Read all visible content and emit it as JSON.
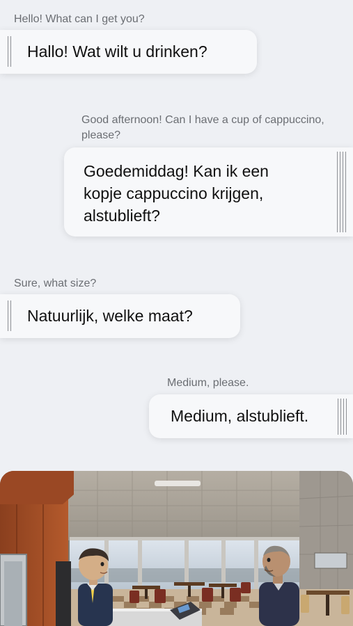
{
  "conversation": [
    {
      "speaker": "barista",
      "english": "Hello! What can I get you?",
      "dutch": "Hallo! Wat wilt u drinken?"
    },
    {
      "speaker": "customer",
      "english": "Good afternoon! Can I have a cup of cappuccino, please?",
      "dutch": "Goedemiddag! Kan ik een kopje cappuccino krijgen, alstublieft?"
    },
    {
      "speaker": "barista",
      "english": "Sure, what size?",
      "dutch": "Natuurlijk, welke maat?"
    },
    {
      "speaker": "customer",
      "english": "Medium, please.",
      "dutch": "Medium, alstublieft."
    }
  ]
}
